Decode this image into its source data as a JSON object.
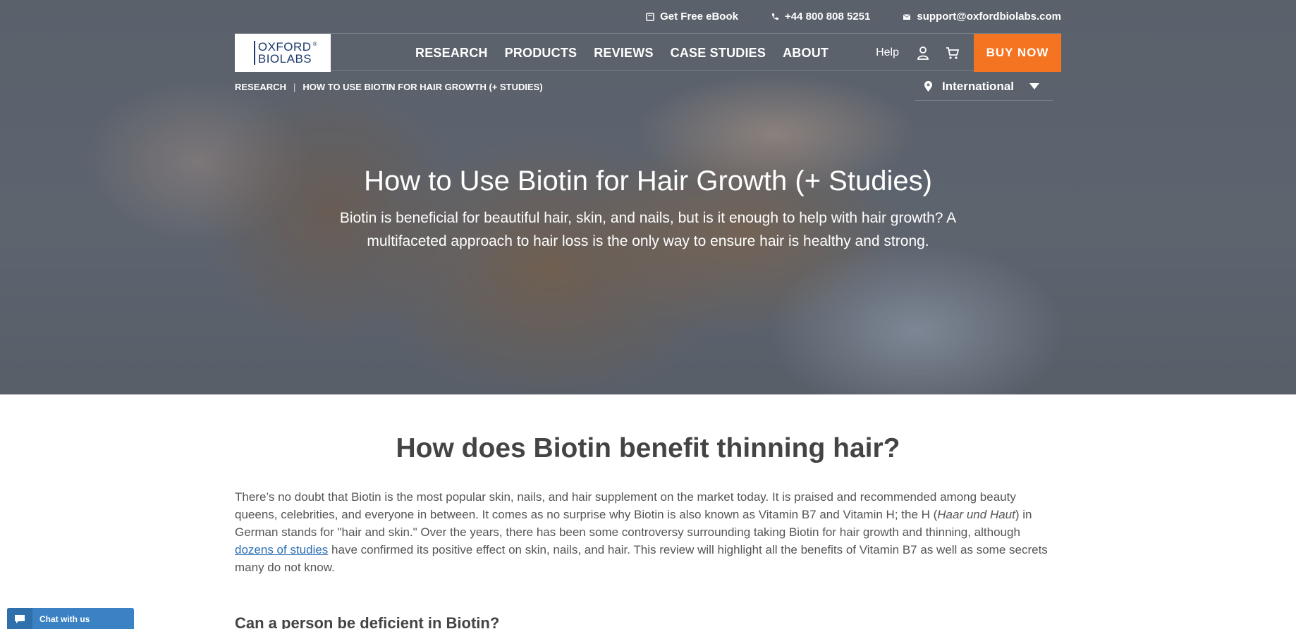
{
  "utility": {
    "ebook": "Get Free eBook",
    "phone": "+44 800 808 5251",
    "email": "support@oxfordbiolabs.com"
  },
  "logo": {
    "line1": "OXFORD",
    "line2": "BIOLABS",
    "reg": "®"
  },
  "nav": {
    "items": [
      "RESEARCH",
      "PRODUCTS",
      "REVIEWS",
      "CASE STUDIES",
      "ABOUT"
    ],
    "help": "Help",
    "buy": "BUY NOW"
  },
  "breadcrumb": {
    "parent": "RESEARCH",
    "current": "HOW TO USE BIOTIN FOR HAIR GROWTH (+ STUDIES)",
    "sep": "|"
  },
  "region": "International",
  "hero": {
    "title": "How to Use Biotin for Hair Growth (+ Studies)",
    "subtitle": "Biotin is beneficial for beautiful hair, skin, and nails, but is it enough to help with hair growth? A multifaceted approach to hair loss is the only way to ensure hair is healthy and strong."
  },
  "article": {
    "heading": "How does Biotin benefit thinning hair?",
    "p1a": "There’s no doubt that Biotin is the most popular skin, nails, and hair supplement on the market today. It is praised and recommended among beauty queens, celebrities, and everyone in between. It comes as no surprise why Biotin is also known as Vitamin B7 and Vitamin H; the H (",
    "p1em": "Haar und Haut",
    "p1b": ") in German stands for \"hair and skin.\"  Over the years, there has been some controversy surrounding taking Biotin for hair growth and thinning, although ",
    "p1link": "dozens of studies",
    "p1c": " have confirmed its positive effect on skin, nails, and hair. This review will highlight all the benefits of Vitamin B7 as well as some secrets many do not know.",
    "subheading": "Can a person be deficient in Biotin?"
  },
  "chat": {
    "label": "Chat with us"
  },
  "colors": {
    "accent": "#f47421",
    "link": "#2c6fb3",
    "chat": "#3a82c4"
  }
}
